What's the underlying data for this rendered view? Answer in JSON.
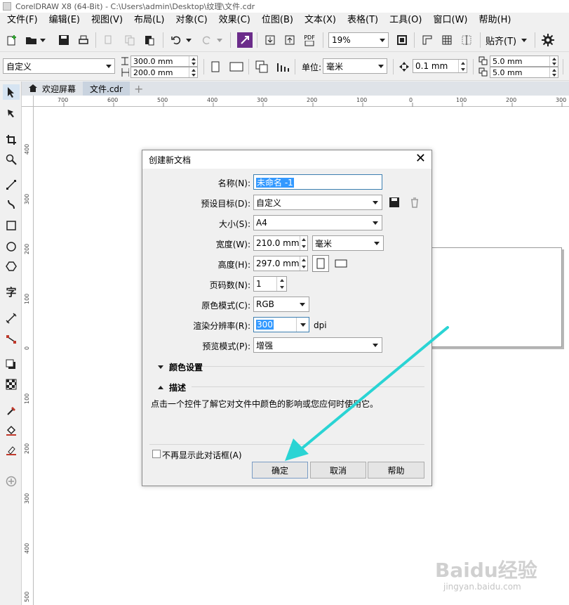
{
  "window": {
    "title": "CorelDRAW X8 (64-Bit) - C:\\Users\\admin\\Desktop\\纹理\\文件.cdr"
  },
  "menu": [
    "文件(F)",
    "编辑(E)",
    "视图(V)",
    "布局(L)",
    "对象(C)",
    "效果(C)",
    "位图(B)",
    "文本(X)",
    "表格(T)",
    "工具(O)",
    "窗口(W)",
    "帮助(H)"
  ],
  "toolbar": {
    "zoom_value": "19%",
    "snap_label": "贴齐(T)",
    "pdf_label": "PDF"
  },
  "propertybar": {
    "preset": "自定义",
    "page_width": "300.0 mm",
    "page_height": "200.0 mm",
    "units_label": "单位:",
    "units_value": "毫米",
    "nudge": "0.1 mm",
    "dup_x": "5.0 mm",
    "dup_y": "5.0 mm"
  },
  "tabs": {
    "welcome": "欢迎屏幕",
    "file": "文件.cdr"
  },
  "ruler": {
    "h_ticks": [
      "700",
      "600",
      "500",
      "400",
      "300",
      "200",
      "100",
      "0",
      "100",
      "200",
      "300"
    ],
    "v_ticks": [
      "400",
      "300",
      "200",
      "100",
      "0",
      "100",
      "200",
      "300",
      "400",
      "500"
    ],
    "unit": "毫米"
  },
  "dialog": {
    "title": "创建新文档",
    "name_label": "名称(N):",
    "name_value": "未命名 -1",
    "preset_label": "预设目标(D):",
    "preset_value": "自定义",
    "size_label": "大小(S):",
    "size_value": "A4",
    "width_label": "宽度(W):",
    "width_value": "210.0 mm",
    "unit_value": "毫米",
    "height_label": "高度(H):",
    "height_value": "297.0 mm",
    "pages_label": "页码数(N):",
    "pages_value": "1",
    "color_mode_label": "原色模式(C):",
    "color_mode_value": "RGB",
    "dpi_label": "渲染分辨率(R):",
    "dpi_value": "300",
    "dpi_unit": "dpi",
    "preview_label": "预览模式(P):",
    "preview_value": "增强",
    "color_settings": "颜色设置",
    "description": "描述",
    "description_text": "点击一个控件了解它对文件中颜色的影响或您应何时使用它。",
    "dont_show": "不再显示此对话框(A)",
    "ok": "确定",
    "cancel": "取消",
    "help": "帮助"
  },
  "watermark": {
    "main": "Baidu经验",
    "sub": "jingyan.baidu.com"
  },
  "colors": {
    "arrow": "#2ad4d4",
    "selection": "#3399ff"
  }
}
